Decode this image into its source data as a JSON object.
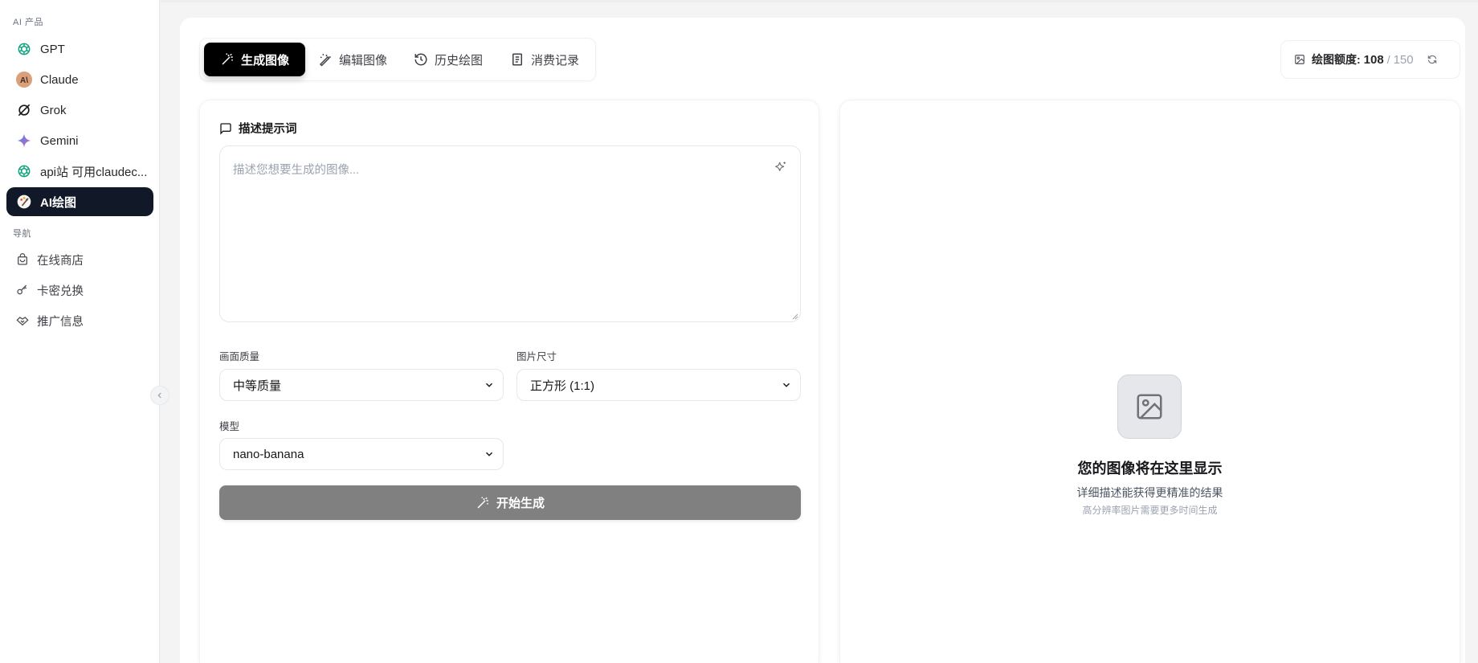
{
  "sidebar": {
    "section_ai": "AI 产品",
    "section_nav": "导航",
    "ai_items": [
      {
        "label": "GPT",
        "icon": "openai-icon"
      },
      {
        "label": "Claude",
        "icon": "claude-icon"
      },
      {
        "label": "Grok",
        "icon": "grok-icon"
      },
      {
        "label": "Gemini",
        "icon": "gemini-icon"
      },
      {
        "label": "api站 可用claudec...",
        "icon": "openai-icon"
      },
      {
        "label": "AI绘图",
        "icon": "palette-icon",
        "active": true
      }
    ],
    "nav_items": [
      {
        "label": "在线商店",
        "icon": "shopping-bag-icon"
      },
      {
        "label": "卡密兑换",
        "icon": "key-icon"
      },
      {
        "label": "推广信息",
        "icon": "handshake-icon"
      }
    ]
  },
  "tabs": [
    {
      "label": "生成图像",
      "icon": "magic-wand-icon",
      "active": true
    },
    {
      "label": "编辑图像",
      "icon": "edit-image-icon"
    },
    {
      "label": "历史绘图",
      "icon": "history-icon"
    },
    {
      "label": "消费记录",
      "icon": "receipt-icon"
    }
  ],
  "quota": {
    "label": "绘图额度:",
    "used": "108",
    "separator": "/",
    "total": "150"
  },
  "prompt": {
    "title": "描述提示词",
    "placeholder": "描述您想要生成的图像..."
  },
  "form": {
    "quality_label": "画面质量",
    "quality_value": "中等质量",
    "size_label": "图片尺寸",
    "size_value": "正方形 (1:1)",
    "model_label": "模型",
    "model_value": "nano-banana",
    "generate_button": "开始生成"
  },
  "preview": {
    "title": "您的图像将在这里显示",
    "subtitle": "详细描述能获得更精准的结果",
    "hint": "高分辨率图片需要更多时间生成"
  },
  "colors": {
    "sidebar_active_bg": "#111827",
    "tab_active_bg": "#000000",
    "generate_button_bg": "#808080",
    "gpt_green": "#10a37f",
    "claude_orange": "#d97757"
  }
}
